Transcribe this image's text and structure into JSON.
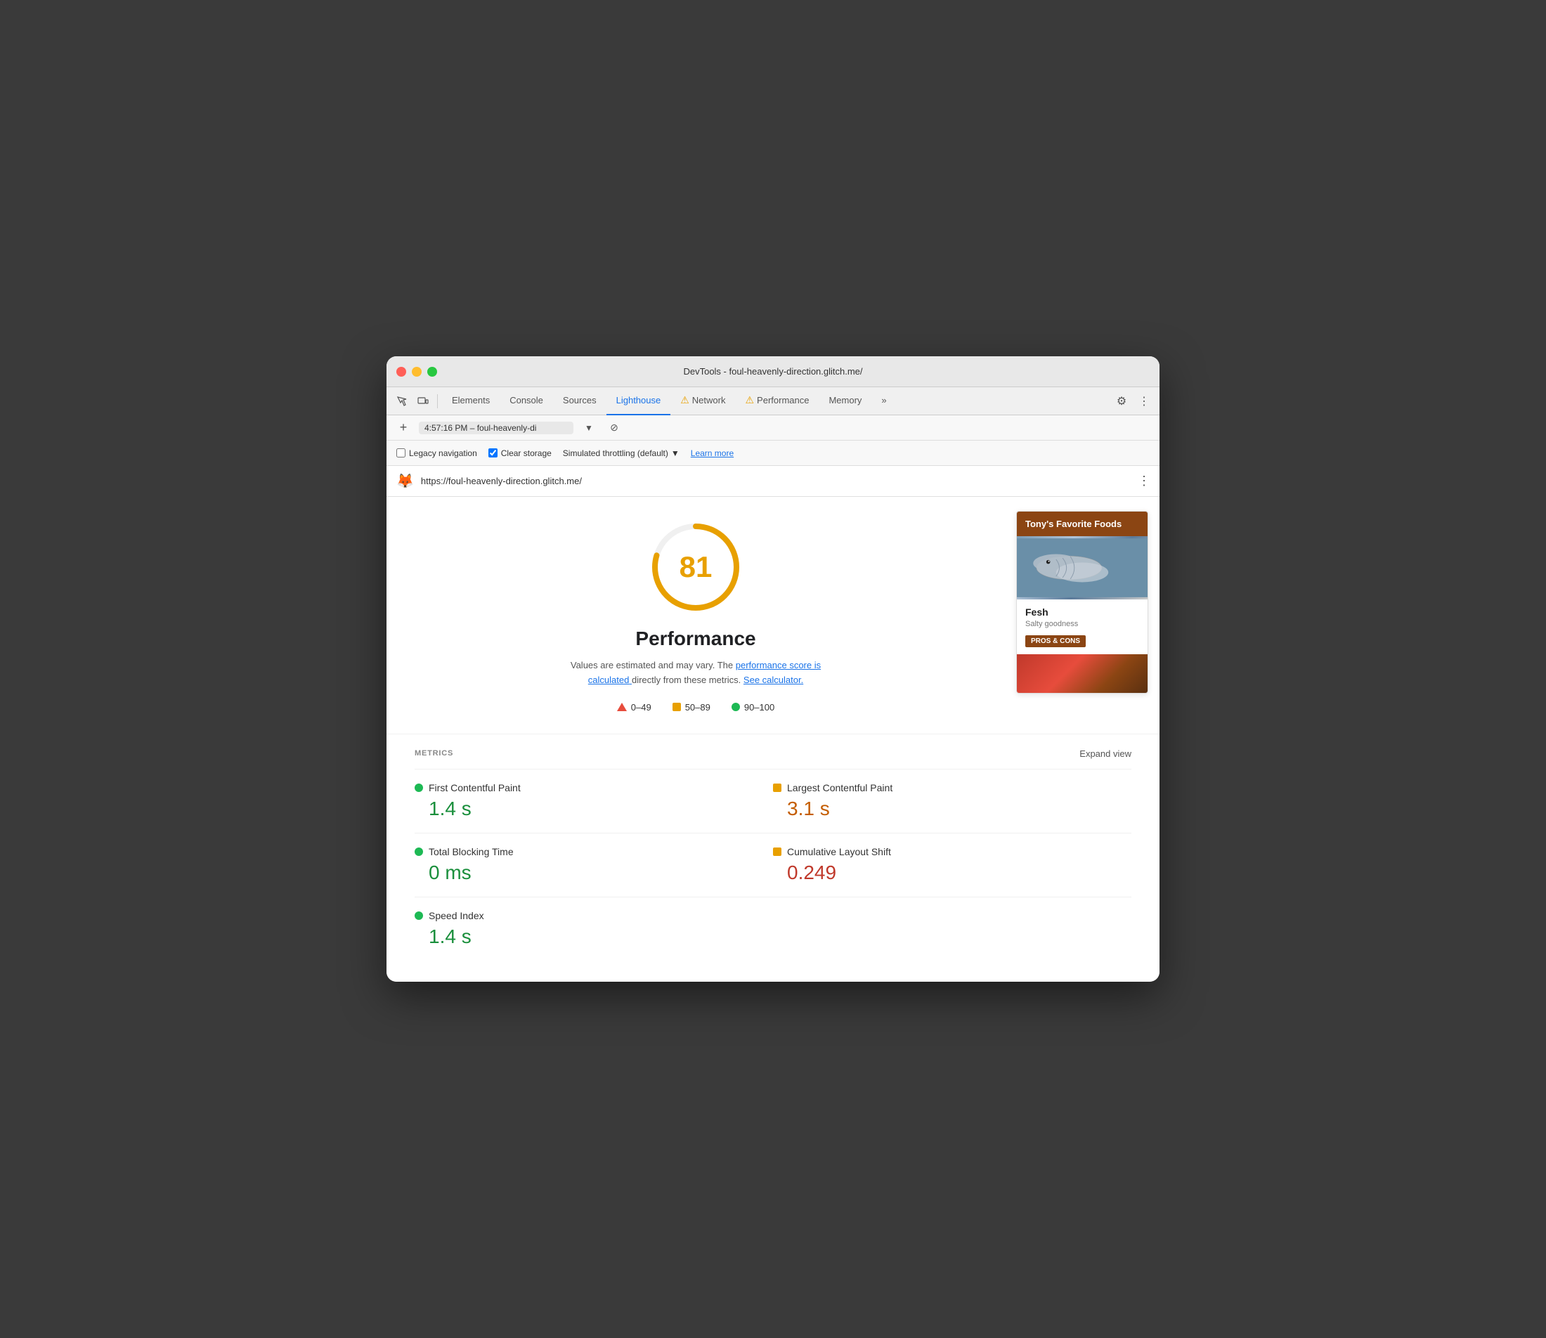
{
  "window": {
    "title": "DevTools - foul-heavenly-direction.glitch.me/"
  },
  "tabs": [
    {
      "id": "elements",
      "label": "Elements",
      "active": false,
      "warning": false
    },
    {
      "id": "console",
      "label": "Console",
      "active": false,
      "warning": false
    },
    {
      "id": "sources",
      "label": "Sources",
      "active": false,
      "warning": false
    },
    {
      "id": "lighthouse",
      "label": "Lighthouse",
      "active": true,
      "warning": false
    },
    {
      "id": "network",
      "label": "Network",
      "active": false,
      "warning": true
    },
    {
      "id": "performance",
      "label": "Performance",
      "active": false,
      "warning": true
    },
    {
      "id": "memory",
      "label": "Memory",
      "active": false,
      "warning": false
    }
  ],
  "url_bar": {
    "timestamp": "4:57:16 PM – foul-heavenly-di",
    "site_url": "https://foul-heavenly-direction.glitch.me/"
  },
  "options": {
    "legacy_navigation_label": "Legacy navigation",
    "legacy_navigation_checked": false,
    "clear_storage_label": "Clear storage",
    "clear_storage_checked": true,
    "throttling_label": "Simulated throttling (default)",
    "learn_more_label": "Learn more"
  },
  "score": {
    "value": "81",
    "color": "#e8a000"
  },
  "performance": {
    "title": "Performance",
    "description_static": "Values are estimated and may vary. The",
    "performance_score_link": "performance score is calculated",
    "description_mid": "directly from these metrics.",
    "calculator_link": "See calculator.",
    "legend": [
      {
        "id": "low",
        "range": "0–49",
        "type": "triangle"
      },
      {
        "id": "mid",
        "range": "50–89",
        "type": "square"
      },
      {
        "id": "high",
        "range": "90–100",
        "type": "circle"
      }
    ]
  },
  "preview_card": {
    "header": "Tony's Favorite Foods",
    "food_name": "Fesh",
    "food_desc": "Salty goodness",
    "button_label": "PROS & CONS"
  },
  "metrics": {
    "section_label": "METRICS",
    "expand_label": "Expand view",
    "items": [
      {
        "id": "fcp",
        "name": "First Contentful Paint",
        "value": "1.4 s",
        "dot_type": "green",
        "value_class": "green"
      },
      {
        "id": "lcp",
        "name": "Largest Contentful Paint",
        "value": "3.1 s",
        "dot_type": "orange",
        "value_class": "orange"
      },
      {
        "id": "tbt",
        "name": "Total Blocking Time",
        "value": "0 ms",
        "dot_type": "green",
        "value_class": "green"
      },
      {
        "id": "cls",
        "name": "Cumulative Layout Shift",
        "value": "0.249",
        "dot_type": "orange",
        "value_class": "red"
      },
      {
        "id": "si",
        "name": "Speed Index",
        "value": "1.4 s",
        "dot_type": "green",
        "value_class": "green"
      }
    ]
  }
}
